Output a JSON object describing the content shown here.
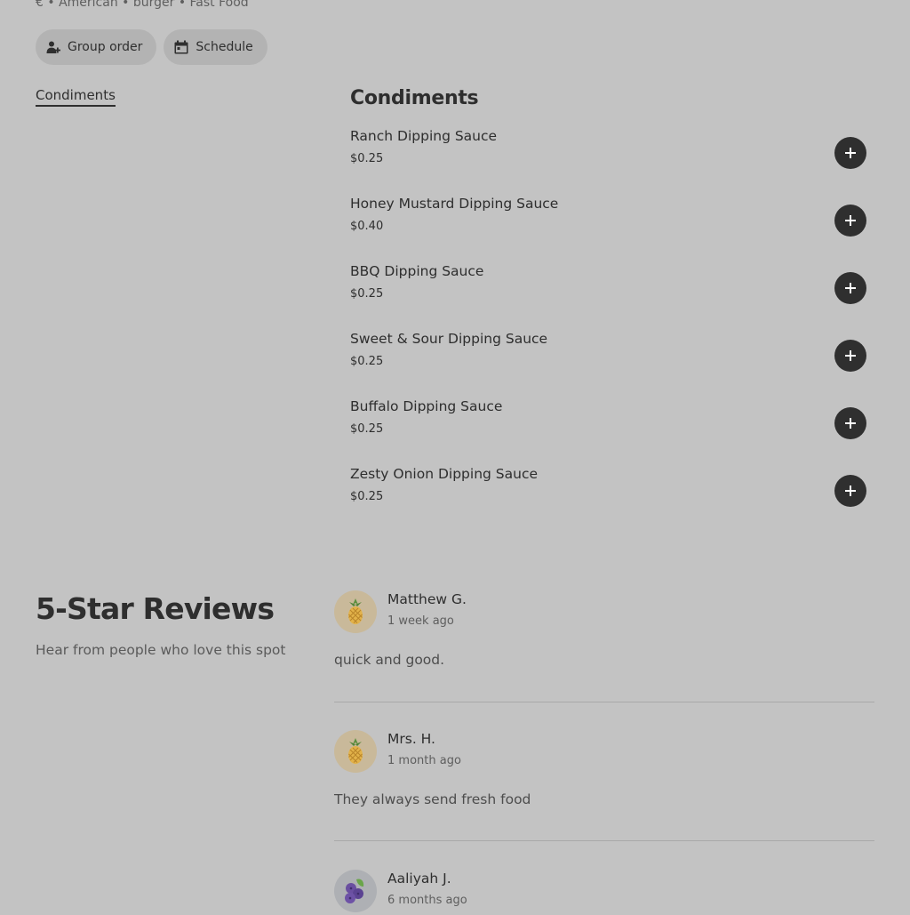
{
  "store": {
    "meta": "€ • American • burger • Fast Food"
  },
  "actions": {
    "group_order_label": "Group order",
    "schedule_label": "Schedule"
  },
  "category_nav": {
    "items": [
      {
        "label": "Condiments"
      }
    ]
  },
  "menu": {
    "section_title": "Condiments",
    "items": [
      {
        "name": "Ranch Dipping Sauce",
        "price": "$0.25"
      },
      {
        "name": "Honey Mustard Dipping Sauce",
        "price": "$0.40"
      },
      {
        "name": "BBQ Dipping Sauce",
        "price": "$0.25"
      },
      {
        "name": "Sweet & Sour Dipping Sauce",
        "price": "$0.25"
      },
      {
        "name": "Buffalo Dipping Sauce",
        "price": "$0.25"
      },
      {
        "name": "Zesty Onion Dipping Sauce",
        "price": "$0.25"
      }
    ]
  },
  "reviews": {
    "title": "5-Star Reviews",
    "subtitle": "Hear from people who love this spot",
    "items": [
      {
        "name": "Matthew G.",
        "when": "1 week ago",
        "text": "quick and good.",
        "avatar": "pineapple-icon"
      },
      {
        "name": "Mrs. H.",
        "when": "1 month ago",
        "text": "They always send fresh food",
        "avatar": "pineapple-icon"
      },
      {
        "name": "Aaliyah J.",
        "when": "6 months ago",
        "text": "",
        "avatar": "blueberry-icon"
      }
    ]
  },
  "colors": {
    "background": "#c3c3c3",
    "text": "#2e2e2e",
    "button_dark": "#2f2f2f",
    "pill_bg": "#b3b3b3"
  }
}
